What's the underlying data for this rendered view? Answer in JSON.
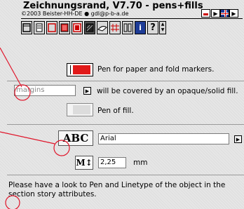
{
  "window": {
    "title": "Zeichnungsrand, V7.70 - pens+fills",
    "copyright": "©2003 Beister-HH-DE ● gdl@p-b-a.de"
  },
  "toolbar": {
    "icons": [
      "frame-icon",
      "page-icon",
      "red-frame-icon",
      "red-square-icon",
      "black-square-icon",
      "hatch-icon",
      "pen-nib-icon",
      "grid-icon",
      "column-icon",
      "info-icon",
      "help-icon",
      "stepper-icon"
    ]
  },
  "pen_row": {
    "label": "Pen for paper and fold markers.",
    "color": "#e11919"
  },
  "fill_row": {
    "value": "margins",
    "label": "will be covered by an opaque/solid fill."
  },
  "pen_fill_row": {
    "label": "Pen of fill."
  },
  "font_row": {
    "abc": "ABC",
    "value": "Arial"
  },
  "size_row": {
    "icon": "M↕",
    "value": "2,25",
    "unit": "mm"
  },
  "note": "Please have a look to Pen and Linetype of the object in the section story attributes.",
  "help_icons": {
    "info": "i",
    "help": "?"
  },
  "colors": {
    "annotation": "#e0162b",
    "pen": "#e11919"
  }
}
